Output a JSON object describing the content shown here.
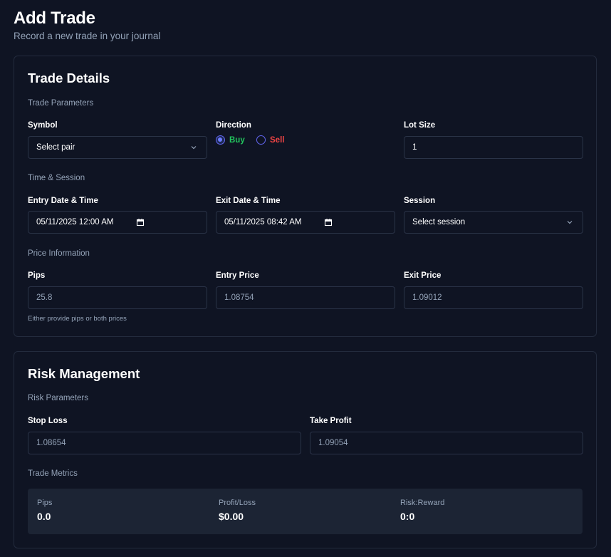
{
  "header": {
    "title": "Add Trade",
    "subtitle": "Record a new trade in your journal"
  },
  "trade_details": {
    "title": "Trade Details",
    "sections": {
      "parameters": "Trade Parameters",
      "time": "Time & Session",
      "price": "Price Information"
    },
    "symbol": {
      "label": "Symbol",
      "value": "Select pair"
    },
    "direction": {
      "label": "Direction",
      "buy": "Buy",
      "sell": "Sell",
      "selected": "Buy"
    },
    "lot_size": {
      "label": "Lot Size",
      "value": "1"
    },
    "entry_datetime": {
      "label": "Entry Date & Time",
      "value": "05/11/2025 12:00 AM"
    },
    "exit_datetime": {
      "label": "Exit Date & Time",
      "value": "05/11/2025 08:42 AM"
    },
    "session": {
      "label": "Session",
      "value": "Select session"
    },
    "pips": {
      "label": "Pips",
      "placeholder": "25.8"
    },
    "entry_price": {
      "label": "Entry Price",
      "placeholder": "1.08754"
    },
    "exit_price": {
      "label": "Exit Price",
      "placeholder": "1.09012"
    },
    "hint": "Either provide pips or both prices"
  },
  "risk_management": {
    "title": "Risk Management",
    "sections": {
      "risk": "Risk Parameters",
      "metrics": "Trade Metrics"
    },
    "stop_loss": {
      "label": "Stop Loss",
      "placeholder": "1.08654"
    },
    "take_profit": {
      "label": "Take Profit",
      "placeholder": "1.09054"
    },
    "metrics": [
      {
        "label": "Pips",
        "value": "0.0"
      },
      {
        "label": "Profit/Loss",
        "value": "$0.00"
      },
      {
        "label": "Risk:Reward",
        "value": "0:0"
      }
    ]
  },
  "colors": {
    "background": "#0f1423",
    "border": "#2a3347",
    "buy": "#22c55e",
    "sell": "#ef4444",
    "accent": "#6366f1"
  }
}
